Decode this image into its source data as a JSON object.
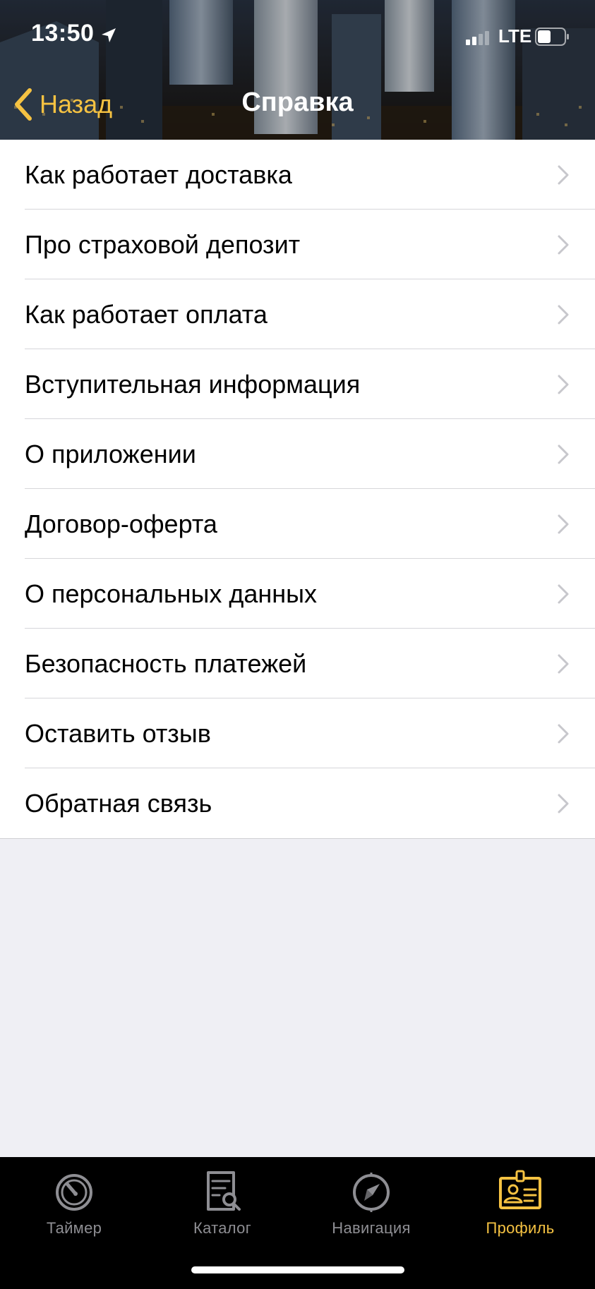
{
  "status_bar": {
    "time": "13:50",
    "location_icon": "location-arrow-icon",
    "signal_icon": "cellular-signal-icon",
    "network": "LTE",
    "battery_icon": "battery-icon"
  },
  "nav": {
    "back_label": "Назад",
    "back_icon": "chevron-left-icon",
    "title": "Справка"
  },
  "colors": {
    "accent": "#f5c242",
    "tab_inactive": "#8e8e93",
    "list_background": "#ffffff",
    "page_background": "#efeff4",
    "tab_bar_background": "#000000"
  },
  "menu": {
    "items": [
      {
        "label": "Как работает доставка"
      },
      {
        "label": "Про страховой депозит"
      },
      {
        "label": "Как работает оплата"
      },
      {
        "label": "Вступительная информация"
      },
      {
        "label": "О приложении"
      },
      {
        "label": "Договор-оферта"
      },
      {
        "label": "О персональных данных"
      },
      {
        "label": "Безопасность платежей"
      },
      {
        "label": "Оставить отзыв"
      },
      {
        "label": "Обратная связь"
      }
    ]
  },
  "tab_bar": {
    "active": "Профиль",
    "tabs": [
      {
        "label": "Таймер",
        "icon": "timer-icon"
      },
      {
        "label": "Каталог",
        "icon": "catalog-icon"
      },
      {
        "label": "Навигация",
        "icon": "compass-icon"
      },
      {
        "label": "Профиль",
        "icon": "profile-badge-icon"
      }
    ]
  }
}
